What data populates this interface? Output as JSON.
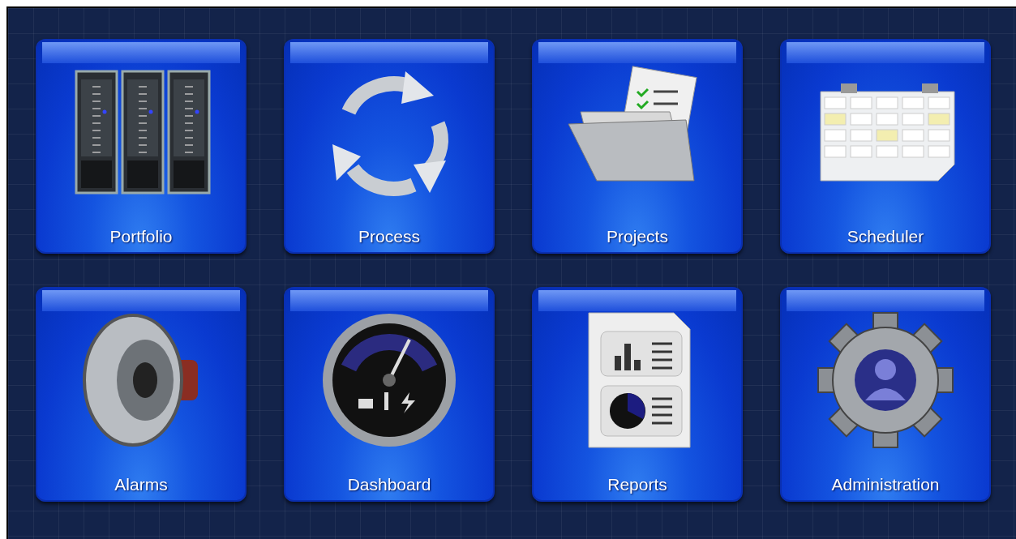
{
  "tiles": [
    {
      "label": "Portfolio",
      "kind": "servers"
    },
    {
      "label": "Process",
      "kind": "cycle"
    },
    {
      "label": "Projects",
      "kind": "folder"
    },
    {
      "label": "Scheduler",
      "kind": "calendar"
    },
    {
      "label": "Alarms",
      "kind": "speaker"
    },
    {
      "label": "Dashboard",
      "kind": "gauge"
    },
    {
      "label": "Reports",
      "kind": "report"
    },
    {
      "label": "Administration",
      "kind": "gear"
    }
  ]
}
